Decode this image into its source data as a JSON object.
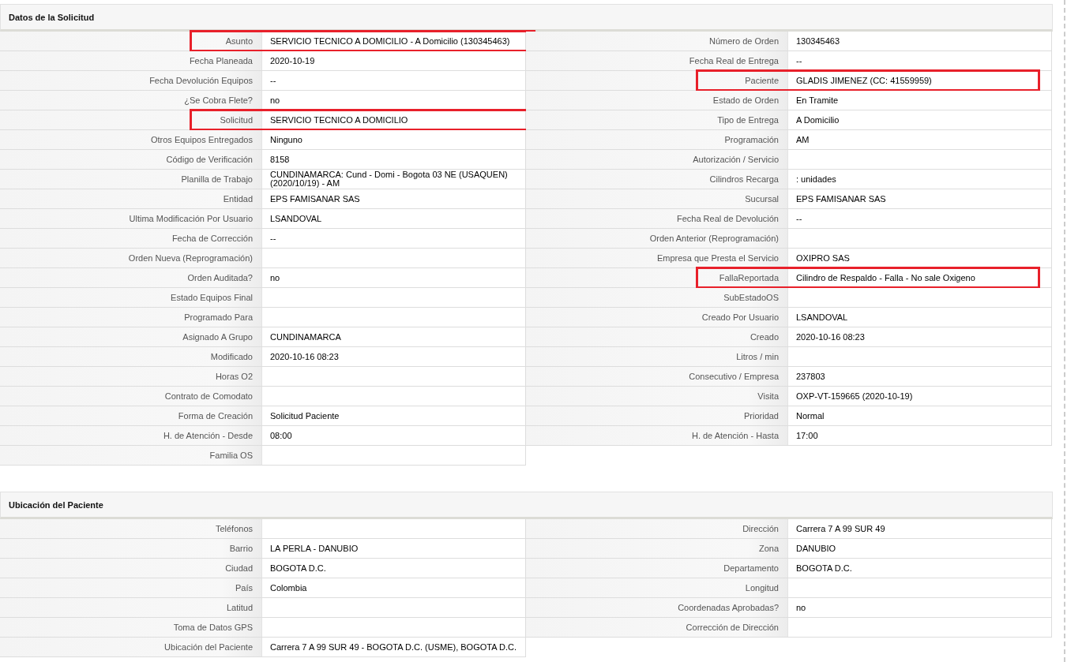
{
  "sections": [
    {
      "title": "Datos de la Solicitud",
      "left": [
        {
          "label": "Asunto",
          "value": "SERVICIO TECNICO A DOMICILIO - A Domicilio (130345463)",
          "highlighted": true
        },
        {
          "label": "Fecha Planeada",
          "value": "2020-10-19",
          "highlighted": false
        },
        {
          "label": "Fecha Devolución Equipos",
          "value": "--",
          "highlighted": false
        },
        {
          "label": "¿Se Cobra Flete?",
          "value": "no",
          "highlighted": false
        },
        {
          "label": "Solicitud",
          "value": "SERVICIO TECNICO A DOMICILIO",
          "highlighted": true
        },
        {
          "label": "Otros Equipos Entregados",
          "value": "Ninguno",
          "highlighted": false
        },
        {
          "label": "Código de Verificación",
          "value": "8158",
          "highlighted": false
        },
        {
          "label": "Planilla de Trabajo",
          "value": "CUNDINAMARCA: Cund - Domi - Bogota 03 NE (USAQUEN) (2020/10/19) - AM",
          "highlighted": false
        },
        {
          "label": "Entidad",
          "value": "EPS FAMISANAR SAS",
          "highlighted": false
        },
        {
          "label": "Ultima Modificación Por Usuario",
          "value": "LSANDOVAL",
          "highlighted": false
        },
        {
          "label": "Fecha de Corrección",
          "value": "--",
          "highlighted": false
        },
        {
          "label": "Orden Nueva (Reprogramación)",
          "highlighted": false
        },
        {
          "label": "Orden Auditada?",
          "value": "no",
          "highlighted": false
        },
        {
          "label": "Estado Equipos Final",
          "highlighted": false
        },
        {
          "label": "Programado Para",
          "highlighted": false
        },
        {
          "label": "Asignado A Grupo",
          "value": "CUNDINAMARCA",
          "highlighted": false
        },
        {
          "label": "Modificado",
          "value": "2020-10-16 08:23",
          "highlighted": false
        },
        {
          "label": "Horas O2",
          "highlighted": false
        },
        {
          "label": "Contrato de Comodato",
          "highlighted": false
        },
        {
          "label": "Forma de Creación",
          "value": "Solicitud Paciente",
          "highlighted": false
        },
        {
          "label": "H. de Atención - Desde",
          "value": "08:00",
          "highlighted": false
        },
        {
          "label": "Familia OS",
          "highlighted": false
        }
      ],
      "right": [
        {
          "label": "Número de Orden",
          "value": "130345463",
          "highlighted": false
        },
        {
          "label": "Fecha Real de Entrega",
          "value": "--",
          "highlighted": false
        },
        {
          "label": "Paciente",
          "value": "GLADIS JIMENEZ (CC: 41559959)",
          "highlighted": true
        },
        {
          "label": "Estado de Orden",
          "value": "En Tramite",
          "highlighted": false
        },
        {
          "label": "Tipo de Entrega",
          "value": "A Domicilio",
          "highlighted": false
        },
        {
          "label": "Programación",
          "value": "AM",
          "highlighted": false
        },
        {
          "label": "Autorización / Servicio",
          "highlighted": false
        },
        {
          "label": "Cilindros Recarga",
          "value": ": unidades",
          "highlighted": false
        },
        {
          "label": "Sucursal",
          "value": "EPS FAMISANAR SAS",
          "highlighted": false
        },
        {
          "label": "Fecha Real de Devolución",
          "value": "--",
          "highlighted": false
        },
        {
          "label": "Orden Anterior (Reprogramación)",
          "highlighted": false
        },
        {
          "label": "Empresa que Presta el Servicio",
          "value": "OXIPRO SAS",
          "highlighted": false
        },
        {
          "label": "FallaReportada",
          "value": "Cilindro de Respaldo - Falla - No sale Oxigeno",
          "highlighted": true
        },
        {
          "label": "SubEstadoOS",
          "highlighted": false
        },
        {
          "label": "Creado Por Usuario",
          "value": "LSANDOVAL",
          "highlighted": false
        },
        {
          "label": "Creado",
          "value": "2020-10-16 08:23",
          "highlighted": false
        },
        {
          "label": "Litros / min",
          "highlighted": false
        },
        {
          "label": "Consecutivo / Empresa",
          "value": "237803",
          "highlighted": false
        },
        {
          "label": "Visita",
          "value": "OXP-VT-159665 (2020-10-19)",
          "highlighted": false
        },
        {
          "label": "Prioridad",
          "value": "Normal",
          "highlighted": false
        },
        {
          "label": "H. de Atención - Hasta",
          "value": "17:00",
          "highlighted": false
        }
      ]
    },
    {
      "title": "Ubicación del Paciente",
      "left": [
        {
          "label": "Teléfonos",
          "highlighted": false
        },
        {
          "label": "Barrio",
          "value": "LA PERLA - DANUBIO",
          "highlighted": false
        },
        {
          "label": "Ciudad",
          "value": "BOGOTA D.C.",
          "highlighted": false
        },
        {
          "label": "País",
          "value": "Colombia",
          "highlighted": false
        },
        {
          "label": "Latitud",
          "highlighted": false
        },
        {
          "label": "Toma de Datos GPS",
          "highlighted": false
        },
        {
          "label": "Ubicación del Paciente",
          "value": "Carrera 7 A 99 SUR 49 - BOGOTA D.C. (USME), BOGOTA D.C.",
          "highlighted": false
        }
      ],
      "right": [
        {
          "label": "Dirección",
          "value": "Carrera 7 A 99 SUR 49",
          "highlighted": false
        },
        {
          "label": "Zona",
          "value": "DANUBIO",
          "highlighted": false
        },
        {
          "label": "Departamento",
          "value": "BOGOTA D.C.",
          "highlighted": false
        },
        {
          "label": "Longitud",
          "highlighted": false
        },
        {
          "label": "Coordenadas Aprobadas?",
          "value": "no",
          "highlighted": false
        },
        {
          "label": "Corrección de Dirección",
          "highlighted": false
        }
      ]
    }
  ]
}
